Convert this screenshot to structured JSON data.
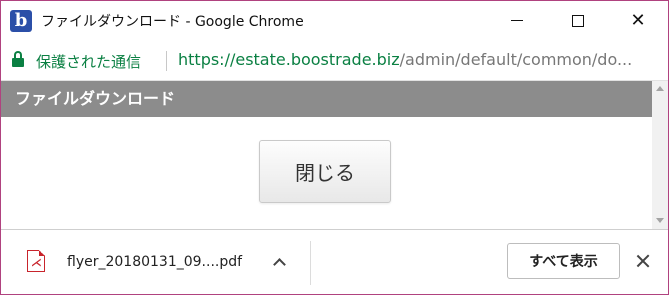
{
  "window": {
    "title": "ファイルダウンロード - Google Chrome",
    "app_icon_letter": "b",
    "close_glyph": "✕"
  },
  "addressbar": {
    "secure_label": "保護された通信",
    "url_host": "https://estate.boostrade.biz",
    "url_path": "/admin/default/common/do..."
  },
  "page": {
    "header_title": "ファイルダウンロード",
    "close_button_label": "閉じる"
  },
  "download_shelf": {
    "items": [
      {
        "filename": "flyer_20180131_09....pdf",
        "icon": "pdf-file-icon"
      }
    ],
    "show_all_label": "すべて表示"
  },
  "colors": {
    "window_border": "#b0427f",
    "secure_green": "#0b8043",
    "header_gray": "#8c8c8c",
    "pdf_red": "#c8242c",
    "app_icon_blue": "#2b4fa8"
  }
}
